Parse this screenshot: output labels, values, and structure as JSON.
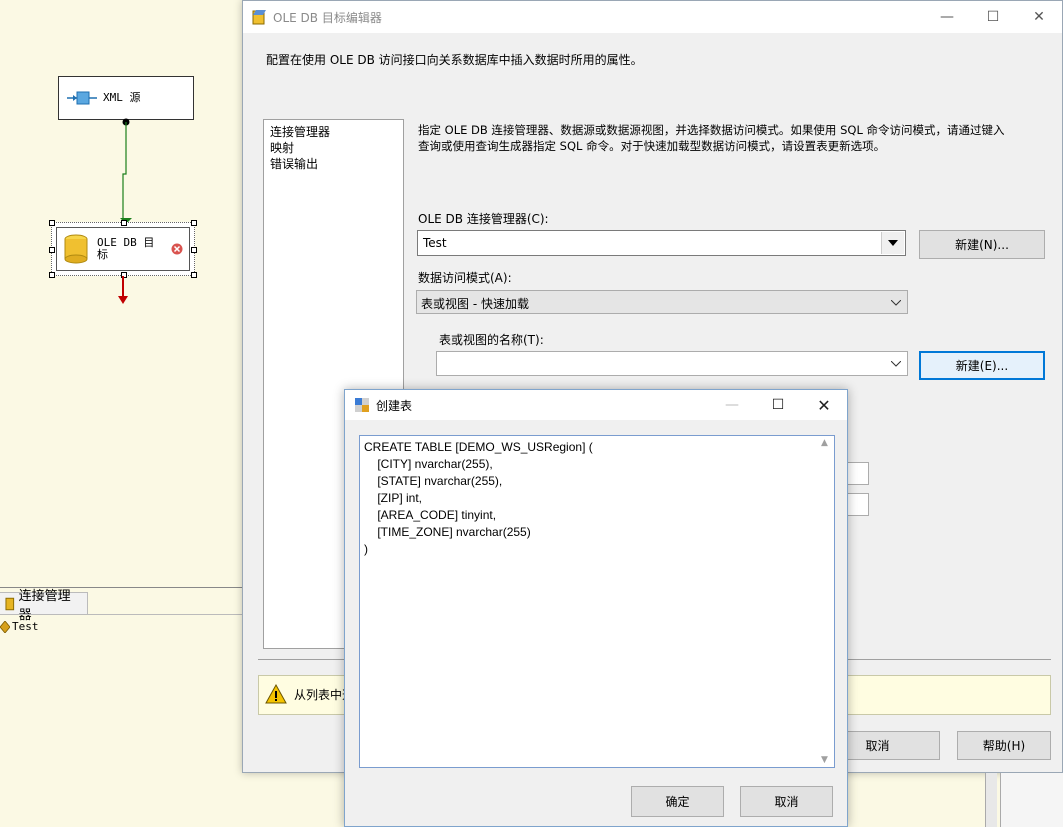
{
  "designer": {
    "xml_source_label": "XML 源",
    "ole_db_dest_label_1": "OLE DB 目",
    "ole_db_dest_label_2": "标"
  },
  "connection_managers": {
    "tab_label": "连接管理器",
    "items": [
      "Test"
    ]
  },
  "main_dialog": {
    "title": "OLE DB 目标编辑器",
    "description": "配置在使用 OLE DB 访问接口向关系数据库中插入数据时所用的属性。",
    "nav_items": [
      "连接管理器",
      "映射",
      "错误输出"
    ],
    "instructions_line1": "指定 OLE DB 连接管理器、数据源或数据源视图，并选择数据访问模式。如果使用 SQL 命令访问模式，请通过键入",
    "instructions_line2": "查询或使用查询生成器指定 SQL 命令。对于快速加载型数据访问模式，请设置表更新选项。",
    "connection_manager_label": "OLE DB 连接管理器(C):",
    "connection_manager_value": "Test",
    "new_connection_button": "新建(N)...",
    "access_mode_label": "数据访问模式(A):",
    "access_mode_value": "表或视图 - 快速加载",
    "table_name_label": "表或视图的名称(T):",
    "table_name_value": "",
    "new_table_button": "新建(E)...",
    "warning_text": "从列表中选",
    "cancel_button": "取消",
    "help_button": "帮助(H)"
  },
  "create_table_dialog": {
    "title": "创建表",
    "sql_lines": [
      "CREATE TABLE [DEMO_WS_USRegion] (",
      "    [CITY] nvarchar(255),",
      "    [STATE] nvarchar(255),",
      "    [ZIP] int,",
      "    [AREA_CODE] tinyint,",
      "    [TIME_ZONE] nvarchar(255)",
      ")"
    ],
    "ok_button": "确定",
    "cancel_button": "取消"
  },
  "colors": {
    "canvas_bg": "#fbf9e4",
    "dialog_bg": "#f0f0f0",
    "focus_blue": "#0078d7",
    "warning_bg": "#fffde1"
  }
}
